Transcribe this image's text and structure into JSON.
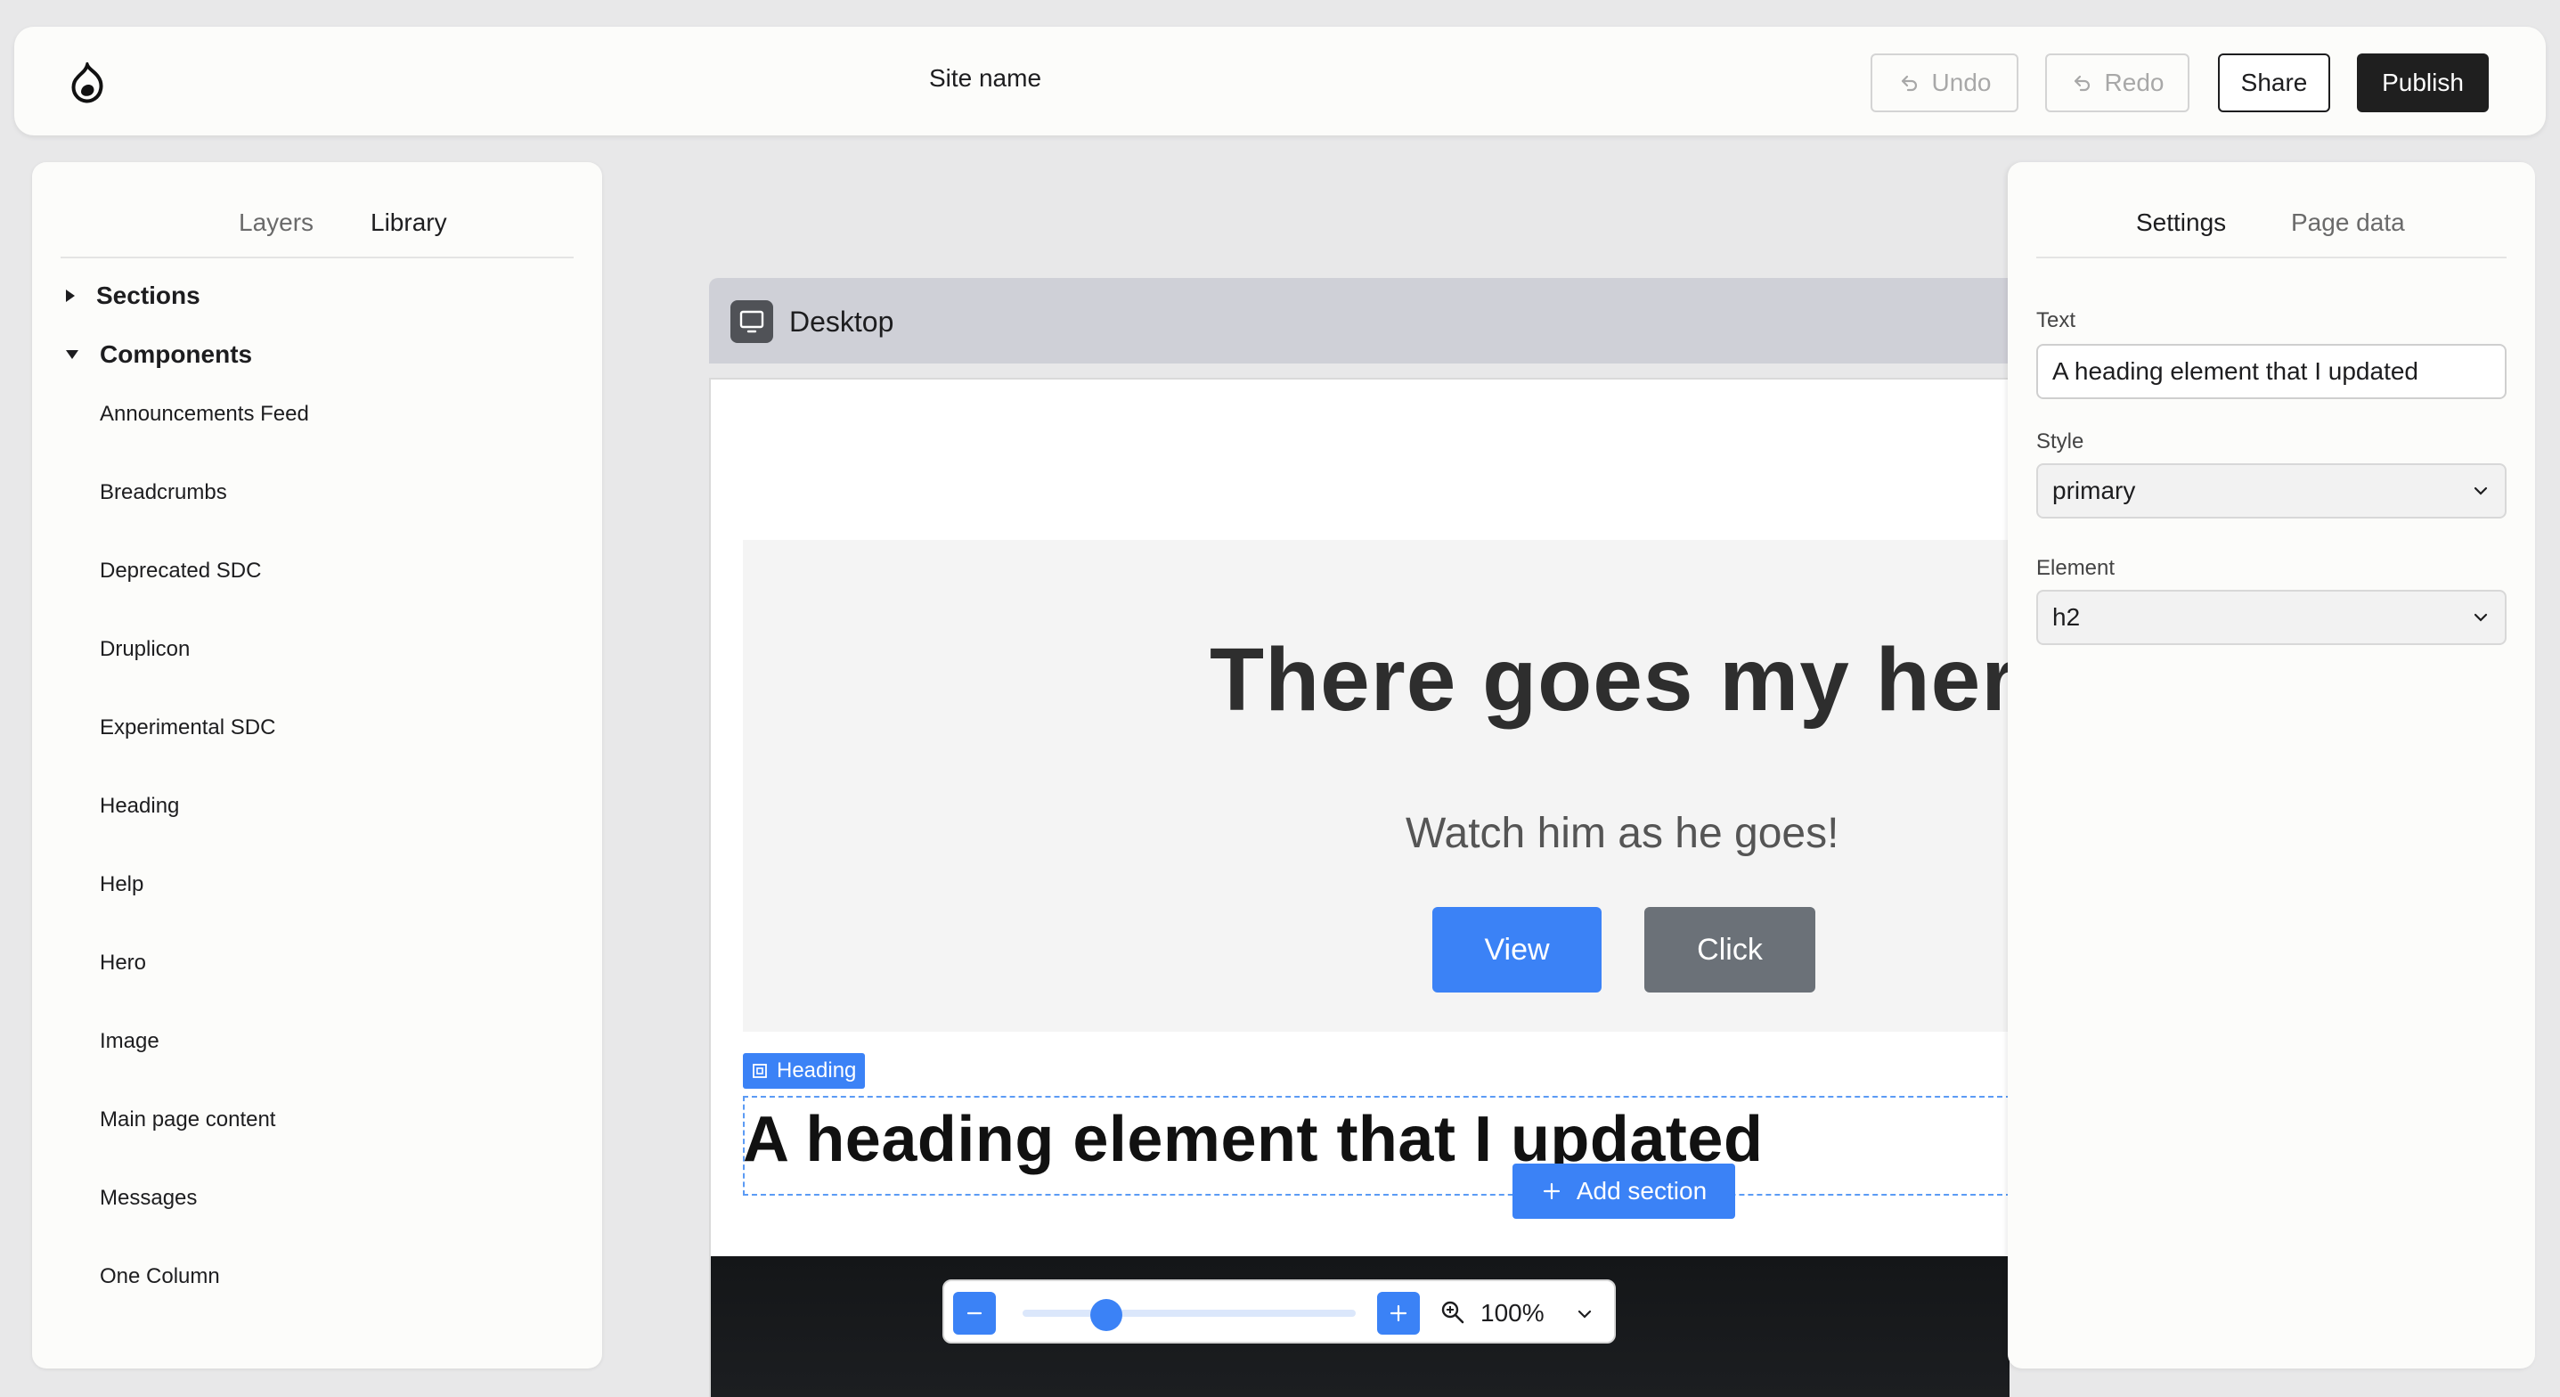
{
  "topbar": {
    "site_name": "Site name",
    "undo_label": "Undo",
    "redo_label": "Redo",
    "share_label": "Share",
    "publish_label": "Publish"
  },
  "left_panel": {
    "tabs": [
      "Layers",
      "Library"
    ],
    "active_tab": "Library",
    "sections_label": "Sections",
    "components_label": "Components",
    "components": [
      "Announcements Feed",
      "Breadcrumbs",
      "Deprecated SDC",
      "Druplicon",
      "Experimental SDC",
      "Heading",
      "Help",
      "Hero",
      "Image",
      "Main page content",
      "Messages",
      "One Column"
    ]
  },
  "canvas": {
    "viewport_label": "Desktop",
    "hero": {
      "title": "There goes my hero",
      "subtitle": "Watch him as he goes!",
      "primary_button": "View",
      "secondary_button": "Click"
    },
    "selected_component_tag": "Heading",
    "heading_text": "A heading element that I updated",
    "add_section_label": "Add section"
  },
  "zoom": {
    "value_label": "100%",
    "level_fraction": 0.25
  },
  "right_panel": {
    "tabs": [
      "Settings",
      "Page data"
    ],
    "active_tab": "Settings",
    "text_label": "Text",
    "text_value": "A heading element that I updated",
    "style_label": "Style",
    "style_value": "primary",
    "element_label": "Element",
    "element_value": "h2"
  },
  "colors": {
    "accent": "#3b82f6",
    "publish_bg": "#1f1f1f",
    "secondary_button": "#6b7178",
    "background": "#e8e8e9"
  },
  "icons": [
    "drupal-logo-icon",
    "undo-icon",
    "redo-icon",
    "monitor-icon",
    "component-icon",
    "plus-icon",
    "minus-icon",
    "zoom-in-icon",
    "chevron-down-icon",
    "caret-right-icon",
    "caret-down-icon"
  ]
}
